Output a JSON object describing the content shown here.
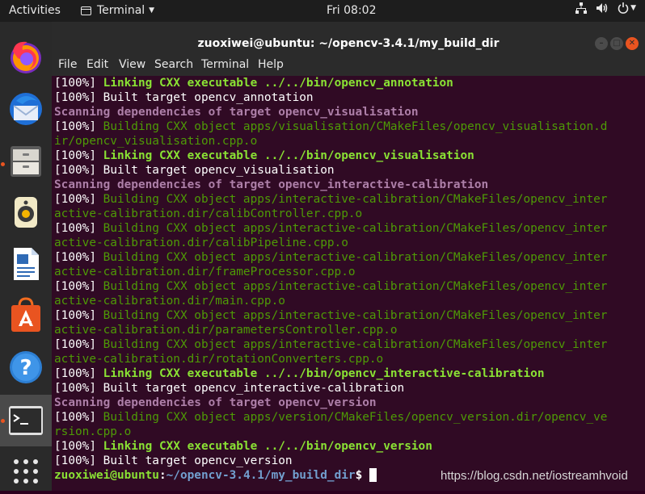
{
  "topbar": {
    "activities": "Activities",
    "app_menu": "Terminal",
    "clock": "Fri 08:02",
    "tray_icons": [
      "network-icon",
      "volume-icon",
      "power-icon"
    ]
  },
  "dock": {
    "apps": [
      "firefox",
      "thunderbird",
      "files",
      "rhythmbox",
      "libreoffice-writer",
      "software-center",
      "help",
      "terminal",
      "show-applications"
    ]
  },
  "window": {
    "title": "zuoxiwei@ubuntu: ~/opencv-3.4.1/my_build_dir",
    "menu": [
      "File",
      "Edit",
      "View",
      "Search",
      "Terminal",
      "Help"
    ]
  },
  "terminal": {
    "lines": [
      {
        "t": "link",
        "p": "[100%] ",
        "s": "Linking CXX executable ../../bin/opencv_annotation"
      },
      {
        "t": "built",
        "p": "[100%] ",
        "s": "Built target opencv_annotation"
      },
      {
        "t": "scan",
        "p": "",
        "s": "Scanning dependencies of target opencv_visualisation"
      },
      {
        "t": "build",
        "p": "[100%] ",
        "s": "Building CXX object apps/visualisation/CMakeFiles/opencv_visualisation.d"
      },
      {
        "t": "build",
        "p": "",
        "s": "ir/opencv_visualisation.cpp.o"
      },
      {
        "t": "link",
        "p": "[100%] ",
        "s": "Linking CXX executable ../../bin/opencv_visualisation"
      },
      {
        "t": "built",
        "p": "[100%] ",
        "s": "Built target opencv_visualisation"
      },
      {
        "t": "scan",
        "p": "",
        "s": "Scanning dependencies of target opencv_interactive-calibration"
      },
      {
        "t": "build",
        "p": "[100%] ",
        "s": "Building CXX object apps/interactive-calibration/CMakeFiles/opencv_inter"
      },
      {
        "t": "build",
        "p": "",
        "s": "active-calibration.dir/calibController.cpp.o"
      },
      {
        "t": "build",
        "p": "[100%] ",
        "s": "Building CXX object apps/interactive-calibration/CMakeFiles/opencv_inter"
      },
      {
        "t": "build",
        "p": "",
        "s": "active-calibration.dir/calibPipeline.cpp.o"
      },
      {
        "t": "build",
        "p": "[100%] ",
        "s": "Building CXX object apps/interactive-calibration/CMakeFiles/opencv_inter"
      },
      {
        "t": "build",
        "p": "",
        "s": "active-calibration.dir/frameProcessor.cpp.o"
      },
      {
        "t": "build",
        "p": "[100%] ",
        "s": "Building CXX object apps/interactive-calibration/CMakeFiles/opencv_inter"
      },
      {
        "t": "build",
        "p": "",
        "s": "active-calibration.dir/main.cpp.o"
      },
      {
        "t": "build",
        "p": "[100%] ",
        "s": "Building CXX object apps/interactive-calibration/CMakeFiles/opencv_inter"
      },
      {
        "t": "build",
        "p": "",
        "s": "active-calibration.dir/parametersController.cpp.o"
      },
      {
        "t": "build",
        "p": "[100%] ",
        "s": "Building CXX object apps/interactive-calibration/CMakeFiles/opencv_inter"
      },
      {
        "t": "build",
        "p": "",
        "s": "active-calibration.dir/rotationConverters.cpp.o"
      },
      {
        "t": "link",
        "p": "[100%] ",
        "s": "Linking CXX executable ../../bin/opencv_interactive-calibration"
      },
      {
        "t": "built",
        "p": "[100%] ",
        "s": "Built target opencv_interactive-calibration"
      },
      {
        "t": "scan",
        "p": "",
        "s": "Scanning dependencies of target opencv_version"
      },
      {
        "t": "build",
        "p": "[100%] ",
        "s": "Building CXX object apps/version/CMakeFiles/opencv_version.dir/opencv_ve"
      },
      {
        "t": "build",
        "p": "",
        "s": "rsion.cpp.o"
      },
      {
        "t": "link",
        "p": "[100%] ",
        "s": "Linking CXX executable ../../bin/opencv_version"
      },
      {
        "t": "built",
        "p": "[100%] ",
        "s": "Built target opencv_version"
      }
    ],
    "prompt": {
      "user": "zuoxiwei@ubuntu",
      "sep": ":",
      "path": "~/opencv-3.4.1/my_build_dir",
      "symbol": "$"
    }
  },
  "watermark": "https://blog.csdn.net/iostreamhvoid",
  "colors": {
    "terminal_bg": "#300a24",
    "link_green": "#8ae234",
    "build_green": "#4e9a06",
    "scan_purple": "#ad7fa8",
    "path_blue": "#729fcf",
    "ubuntu_orange": "#e95420"
  }
}
